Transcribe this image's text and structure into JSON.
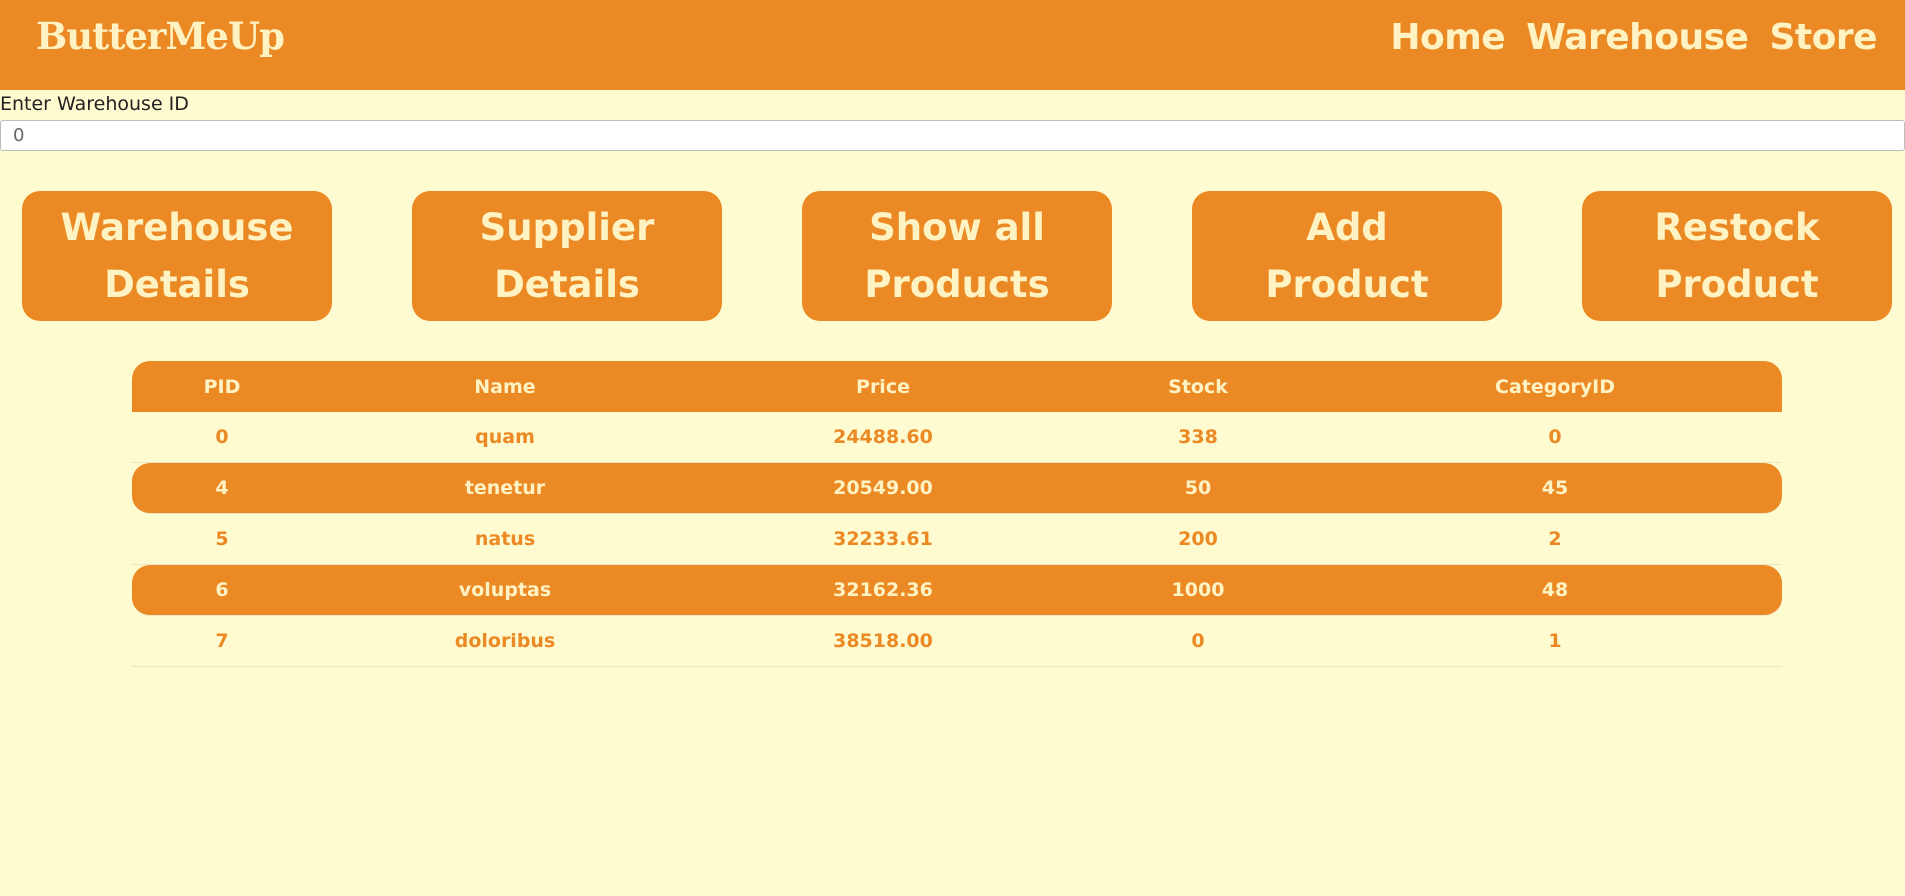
{
  "brand": "ButterMeUp",
  "nav": [
    {
      "label": "Home"
    },
    {
      "label": "Warehouse"
    },
    {
      "label": "Store"
    }
  ],
  "warehouse_id": {
    "label": "Enter Warehouse ID",
    "value": "0"
  },
  "actions": [
    {
      "line1": "Warehouse",
      "line2": "Details"
    },
    {
      "line1": "Supplier",
      "line2": "Details"
    },
    {
      "line1": "Show all",
      "line2": "Products"
    },
    {
      "line1": "Add",
      "line2": "Product"
    },
    {
      "line1": "Restock",
      "line2": "Product"
    }
  ],
  "table": {
    "columns": [
      "PID",
      "Name",
      "Price",
      "Stock",
      "CategoryID"
    ],
    "rows": [
      [
        "0",
        "quam",
        "24488.60",
        "338",
        "0"
      ],
      [
        "4",
        "tenetur",
        "20549.00",
        "50",
        "45"
      ],
      [
        "5",
        "natus",
        "32233.61",
        "200",
        "2"
      ],
      [
        "6",
        "voluptas",
        "32162.36",
        "1000",
        "48"
      ],
      [
        "7",
        "doloribus",
        "38518.00",
        "0",
        "1"
      ]
    ]
  },
  "colors": {
    "accent": "#eb8a25",
    "background": "#fffbd0",
    "text_light": "#fff3c4"
  }
}
